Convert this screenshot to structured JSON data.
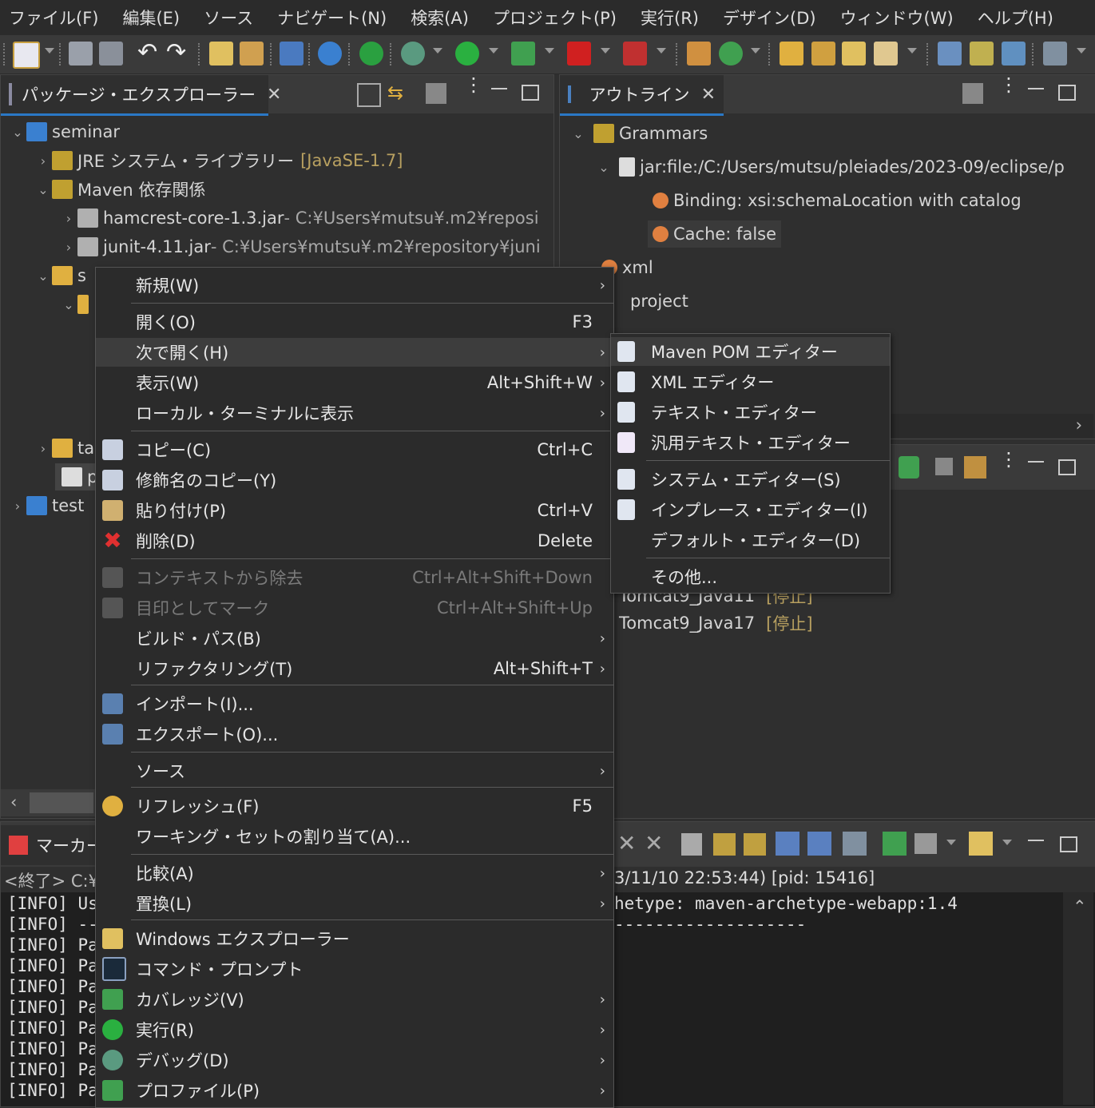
{
  "menubar": [
    "ファイル(F)",
    "編集(E)",
    "ソース",
    "ナビゲート(N)",
    "検索(A)",
    "プロジェクト(P)",
    "実行(R)",
    "デザイン(D)",
    "ウィンドウ(W)",
    "ヘルプ(H)"
  ],
  "package_explorer": {
    "tab_label": "パッケージ・エクスプローラー",
    "tree": [
      {
        "label": "seminar",
        "detail": ""
      },
      {
        "label": "JRE システム・ライブラリー",
        "detail": "[JavaSE-1.7]"
      },
      {
        "label": "Maven 依存関係",
        "detail": ""
      },
      {
        "label": "hamcrest-core-1.3.jar",
        "detail": " - C:¥Users¥mutsu¥.m2¥reposi"
      },
      {
        "label": "junit-4.11.jar",
        "detail": " - C:¥Users¥mutsu¥.m2¥repository¥juni"
      },
      {
        "label": "s",
        "detail": ""
      },
      {
        "label": "ta",
        "detail": ""
      },
      {
        "label": "p",
        "detail": ""
      },
      {
        "label": "test",
        "detail": ""
      }
    ]
  },
  "outline": {
    "tab_label": "アウトライン",
    "tree": [
      {
        "label": "Grammars"
      },
      {
        "label": "jar:file:/C:/Users/mutsu/pleiades/2023-09/eclipse/p"
      },
      {
        "label": "Binding: xsi:schemaLocation with catalog"
      },
      {
        "label": "Cache: false"
      },
      {
        "label": "xml"
      },
      {
        "label": "project"
      }
    ]
  },
  "servers": [
    {
      "name": "Tomcat9_Java11",
      "state": "[停止]"
    },
    {
      "name": "Tomcat9_Java17",
      "state": "[停止]"
    }
  ],
  "bottom": {
    "tab_label": "マーカー",
    "console_header_left": "<終了> C:¥",
    "console_header_right": "3/11/10 22:53:44) [pid: 15416]",
    "lines_left": [
      "[INFO] Us",
      "[INFO] --",
      "[INFO] Pa",
      "[INFO] Pa",
      "[INFO] Pa",
      "[INFO] Pa",
      "[INFO] Pa",
      "[INFO] Pa",
      "[INFO] Pa",
      "[INFO] Pa"
    ],
    "line_right_1": "hetype: maven-archetype-webapp:1.4",
    "line_right_2": "-------------------"
  },
  "context_menu": [
    {
      "label": "新規(W)",
      "shortcut": "",
      "arrow": true
    },
    {
      "label": "開く(O)",
      "shortcut": "F3",
      "arrow": false
    },
    {
      "label": "次で開く(H)",
      "shortcut": "",
      "arrow": true
    },
    {
      "label": "表示(W)",
      "shortcut": "Alt+Shift+W",
      "arrow": true
    },
    {
      "label": "ローカル・ターミナルに表示",
      "shortcut": "",
      "arrow": true
    },
    {
      "label": "コピー(C)",
      "shortcut": "Ctrl+C",
      "arrow": false
    },
    {
      "label": "修飾名のコピー(Y)",
      "shortcut": "",
      "arrow": false
    },
    {
      "label": "貼り付け(P)",
      "shortcut": "Ctrl+V",
      "arrow": false
    },
    {
      "label": "削除(D)",
      "shortcut": "Delete",
      "arrow": false
    },
    {
      "label": "コンテキストから除去",
      "shortcut": "Ctrl+Alt+Shift+Down",
      "arrow": false
    },
    {
      "label": "目印としてマーク",
      "shortcut": "Ctrl+Alt+Shift+Up",
      "arrow": false
    },
    {
      "label": "ビルド・パス(B)",
      "shortcut": "",
      "arrow": true
    },
    {
      "label": "リファクタリング(T)",
      "shortcut": "Alt+Shift+T",
      "arrow": true
    },
    {
      "label": "インポート(I)...",
      "shortcut": "",
      "arrow": false
    },
    {
      "label": "エクスポート(O)...",
      "shortcut": "",
      "arrow": false
    },
    {
      "label": "ソース",
      "shortcut": "",
      "arrow": true
    },
    {
      "label": "リフレッシュ(F)",
      "shortcut": "F5",
      "arrow": false
    },
    {
      "label": "ワーキング・セットの割り当て(A)...",
      "shortcut": "",
      "arrow": false
    },
    {
      "label": "比較(A)",
      "shortcut": "",
      "arrow": true
    },
    {
      "label": "置換(L)",
      "shortcut": "",
      "arrow": true
    },
    {
      "label": "Windows エクスプローラー",
      "shortcut": "",
      "arrow": false
    },
    {
      "label": "コマンド・プロンプト",
      "shortcut": "",
      "arrow": false
    },
    {
      "label": "カバレッジ(V)",
      "shortcut": "",
      "arrow": true
    },
    {
      "label": "実行(R)",
      "shortcut": "",
      "arrow": true
    },
    {
      "label": "デバッグ(D)",
      "shortcut": "",
      "arrow": true
    },
    {
      "label": "プロファイル(P)",
      "shortcut": "",
      "arrow": true
    }
  ],
  "submenu": [
    {
      "label": "Maven POM エディター"
    },
    {
      "label": "XML エディター"
    },
    {
      "label": "テキスト・エディター"
    },
    {
      "label": "汎用テキスト・エディター"
    },
    {
      "label": "システム・エディター(S)"
    },
    {
      "label": "インプレース・エディター(I)"
    },
    {
      "label": "デフォルト・エディター(D)"
    },
    {
      "label": "その他..."
    }
  ]
}
